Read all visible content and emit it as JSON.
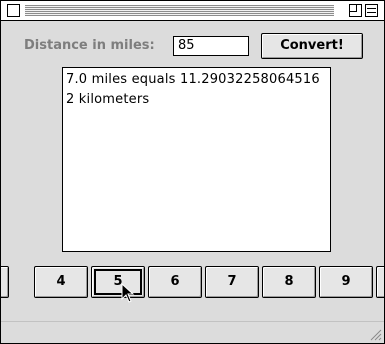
{
  "window": {
    "title": "",
    "controls": [
      "close-box",
      "zoom-box",
      "collapse-box"
    ]
  },
  "form": {
    "distance_label": "Distance in miles:",
    "distance_value": "85",
    "convert_label": "Convert!"
  },
  "output": {
    "text": "7.0 miles equals 11.290322580645162 kilometers"
  },
  "number_buttons": {
    "labels": [
      "4",
      "5",
      "6",
      "7",
      "8",
      "9"
    ],
    "selected": "5"
  },
  "colors": {
    "window_bg": "#dcdcdc",
    "label_gray": "#7e7e7e",
    "button_face": "#e6e6e6"
  }
}
